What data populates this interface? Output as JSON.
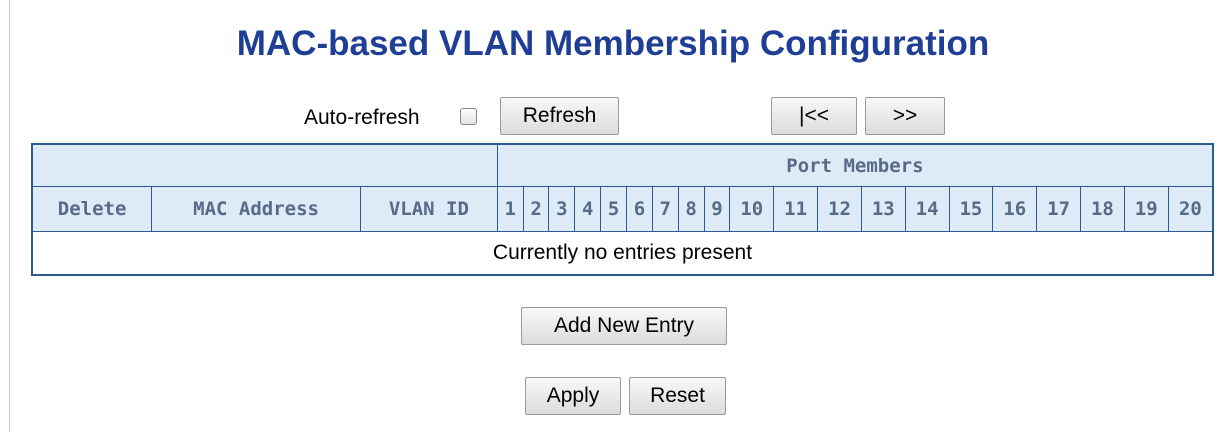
{
  "page": {
    "title": "MAC-based VLAN Membership Configuration"
  },
  "toolbar": {
    "auto_refresh_label": "Auto-refresh",
    "auto_refresh_checked": false,
    "refresh_label": "Refresh",
    "first_label": "|<<",
    "next_label": ">>"
  },
  "table": {
    "group_header": "Port Members",
    "columns": {
      "delete": "Delete",
      "mac_address": "MAC Address",
      "vlan_id": "VLAN ID"
    },
    "ports": [
      "1",
      "2",
      "3",
      "4",
      "5",
      "6",
      "7",
      "8",
      "9",
      "10",
      "11",
      "12",
      "13",
      "14",
      "15",
      "16",
      "17",
      "18",
      "19",
      "20"
    ],
    "empty_message": "Currently no entries present"
  },
  "actions": {
    "add_label": "Add New Entry",
    "apply_label": "Apply",
    "reset_label": "Reset"
  }
}
